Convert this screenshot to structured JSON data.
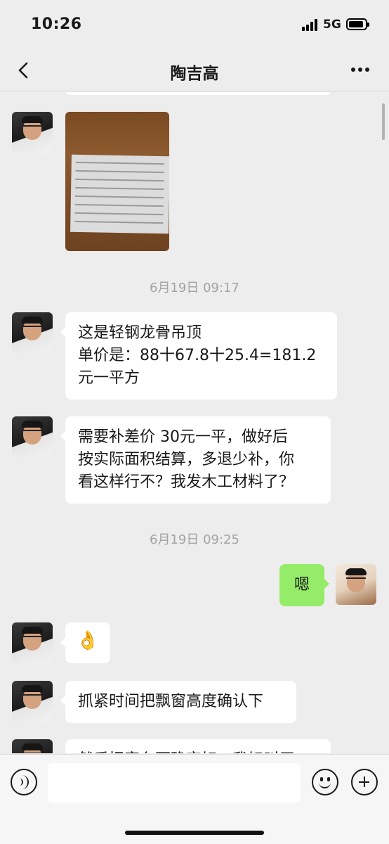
{
  "status_bar": {
    "time": "10:26",
    "network": "5G"
  },
  "nav": {
    "title": "陶吉高",
    "back_icon": "chevron-left-icon",
    "more_icon": "ellipsis-icon"
  },
  "messages": [
    {
      "type": "image",
      "sender": "other",
      "content": "photo of printed price list"
    },
    {
      "type": "timestamp",
      "text": "6月19日 09:17"
    },
    {
      "type": "text",
      "sender": "other",
      "text": "这是轻钢龙骨吊顶\n单价是：88十67.8十25.4=181.2\n元一平方"
    },
    {
      "type": "text",
      "sender": "other",
      "text": "需要补差价 30元一平，做好后\n按实际面积结算，多退少补，你\n看这样行不？我发木工材料了？"
    },
    {
      "type": "timestamp",
      "text": "6月19日 09:25"
    },
    {
      "type": "text",
      "sender": "me",
      "text": "嗯"
    },
    {
      "type": "emoji",
      "sender": "other",
      "text": "👌"
    },
    {
      "type": "text",
      "sender": "other",
      "text": "抓紧时间把飘窗高度确认下"
    },
    {
      "type": "text",
      "sender": "other",
      "text": "然后把窗台面确定好，我好叫厂"
    }
  ],
  "input_bar": {
    "placeholder": "",
    "icons": [
      "voice-icon",
      "emoji-icon",
      "plus-icon"
    ]
  },
  "colors": {
    "background": "#ededed",
    "my_bubble": "#95ec69",
    "other_bubble": "#ffffff",
    "timestamp": "#a3a3a3"
  }
}
